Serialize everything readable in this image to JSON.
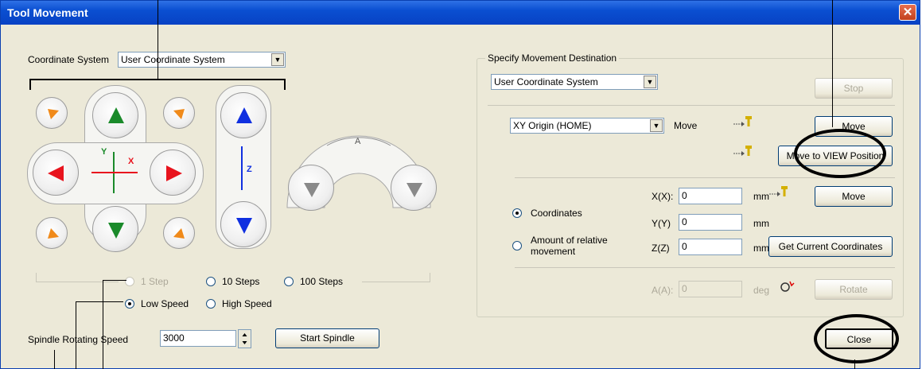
{
  "window": {
    "title": "Tool Movement",
    "close_glyph": "✕"
  },
  "left": {
    "coord_system_label": "Coordinate System",
    "coord_system_value": "User Coordinate System",
    "axis_labels": {
      "y": "Y",
      "x": "X",
      "z": "Z",
      "a": "A"
    },
    "step_options": [
      {
        "label": "1 Step",
        "selected": false,
        "enabled": false
      },
      {
        "label": "10 Steps",
        "selected": false,
        "enabled": true
      },
      {
        "label": "100 Steps",
        "selected": false,
        "enabled": true
      }
    ],
    "speed_options": [
      {
        "label": "Low Speed",
        "selected": true
      },
      {
        "label": "High Speed",
        "selected": false
      }
    ],
    "spindle_label": "Spindle Rotating Speed",
    "spindle_value": "3000",
    "start_spindle": "Start Spindle"
  },
  "right": {
    "group_title": "Specify Movement Destination",
    "dest_coord_system": "User Coordinate System",
    "stop": "Stop",
    "preset_value": "XY Origin (HOME)",
    "preset_move_label": "Move",
    "move": "Move",
    "move_to_view": "Move to VIEW Position",
    "mode_options": [
      {
        "label": "Coordinates",
        "selected": true
      },
      {
        "label": "Amount of relative movement",
        "selected": false
      }
    ],
    "x_label": "X(X):",
    "y_label": "Y(Y)",
    "z_label": "Z(Z)",
    "x_value": "0",
    "y_value": "0",
    "z_value": "0",
    "unit_mm": "mm",
    "coord_move": "Move",
    "get_current": "Get Current Coordinates",
    "a_label": "A(A):",
    "a_value": "0",
    "unit_deg": "deg",
    "rotate": "Rotate"
  },
  "footer": {
    "close": "Close"
  },
  "colors": {
    "up_down_xy": "#1a8a2a",
    "left_right_x": "#e8141e",
    "z": "#1030e0",
    "diag": "#f08a1a",
    "a": "#8a8a8a",
    "title_bg": "#0a4fd1"
  }
}
